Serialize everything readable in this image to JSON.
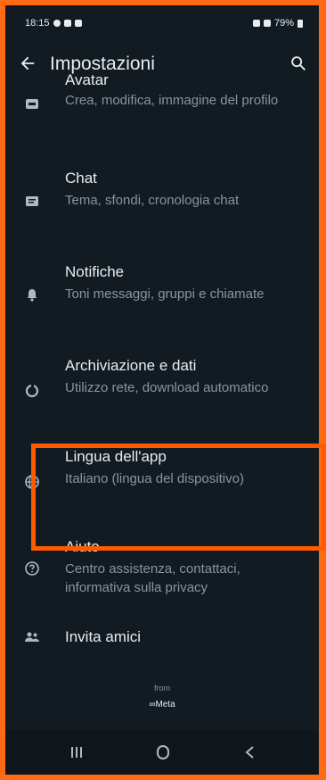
{
  "status_bar": {
    "time": "18:15",
    "battery": "79%"
  },
  "header": {
    "title": "Impostazioni"
  },
  "settings": [
    {
      "key": "avatar",
      "title": "Avatar",
      "subtitle": "Crea, modifica, immagine del profilo",
      "icon": "avatar-icon"
    },
    {
      "key": "chat",
      "title": "Chat",
      "subtitle": "Tema, sfondi, cronologia chat",
      "icon": "chat-icon"
    },
    {
      "key": "notifications",
      "title": "Notifiche",
      "subtitle": "Toni messaggi, gruppi e chiamate",
      "icon": "bell-icon"
    },
    {
      "key": "storage",
      "title": "Archiviazione e dati",
      "subtitle": "Utilizzo rete, download automatico",
      "icon": "data-usage-icon"
    },
    {
      "key": "language",
      "title": "Lingua dell'app",
      "subtitle": "Italiano (lingua del dispositivo)",
      "icon": "globe-icon"
    },
    {
      "key": "help",
      "title": "Aiuto",
      "subtitle": "Centro assistenza, contattaci, informativa sulla privacy",
      "icon": "help-icon"
    },
    {
      "key": "invite",
      "title": "Invita amici",
      "subtitle": "",
      "icon": "people-icon"
    }
  ],
  "footer": {
    "from": "from",
    "brand": "∞Meta"
  },
  "nav": {
    "recent": "recent-apps-icon",
    "home": "home-icon",
    "back": "nav-back-icon"
  },
  "colors": {
    "background": "#121b22",
    "title": "#e9edef",
    "subtitle": "#8696a0",
    "highlight": "#ff5a00",
    "frame": "#ff6a13"
  }
}
